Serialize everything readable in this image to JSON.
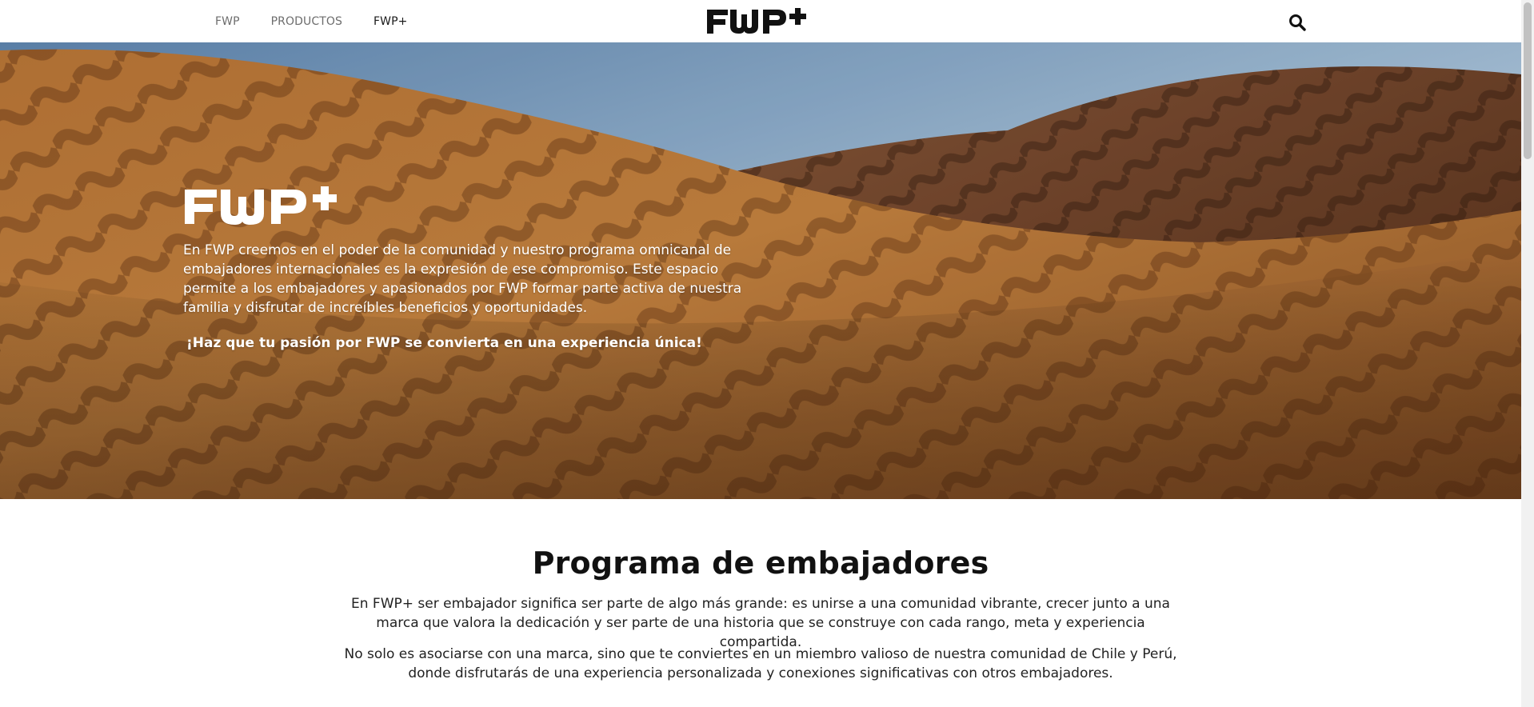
{
  "header": {
    "nav": [
      {
        "label": "FWP",
        "active": false
      },
      {
        "label": "PRODUCTOS",
        "active": false
      },
      {
        "label": "FWP+",
        "active": true
      }
    ],
    "logo": "FWP+",
    "search_icon": "search-icon"
  },
  "hero": {
    "logo": "FWP+",
    "text": "En FWP creemos en el poder de la comunidad y nuestro programa omnicanal de embajadores internacionales es la expresión de ese compromiso. Este espacio permite a los embajadores y apasionados por FWP formar parte activa de nuestra familia y disfrutar de increíbles beneficios y oportunidades.",
    "cta": "¡Haz que tu pasión por FWP se convierta en una experiencia única!"
  },
  "program": {
    "title": "Programa de embajadores",
    "paragraph_1": "En FWP+ ser embajador significa ser parte de algo más grande: es unirse a una comunidad vibrante, crecer junto a una marca que valora la dedicación y ser parte de una historia que se construye con cada rango, meta y experiencia compartida.",
    "paragraph_2": "No solo es asociarse con una marca, sino que te conviertes en un miembro valioso de nuestra comunidad de Chile y Perú, donde disfrutarás de una experiencia personalizada y conexiones significativas con otros embajadores."
  },
  "colors": {
    "sand": "#b8732f",
    "sand_shadow": "#6e3f1c",
    "sky": "#a7c3da",
    "nav_text": "#6d6d6d"
  }
}
